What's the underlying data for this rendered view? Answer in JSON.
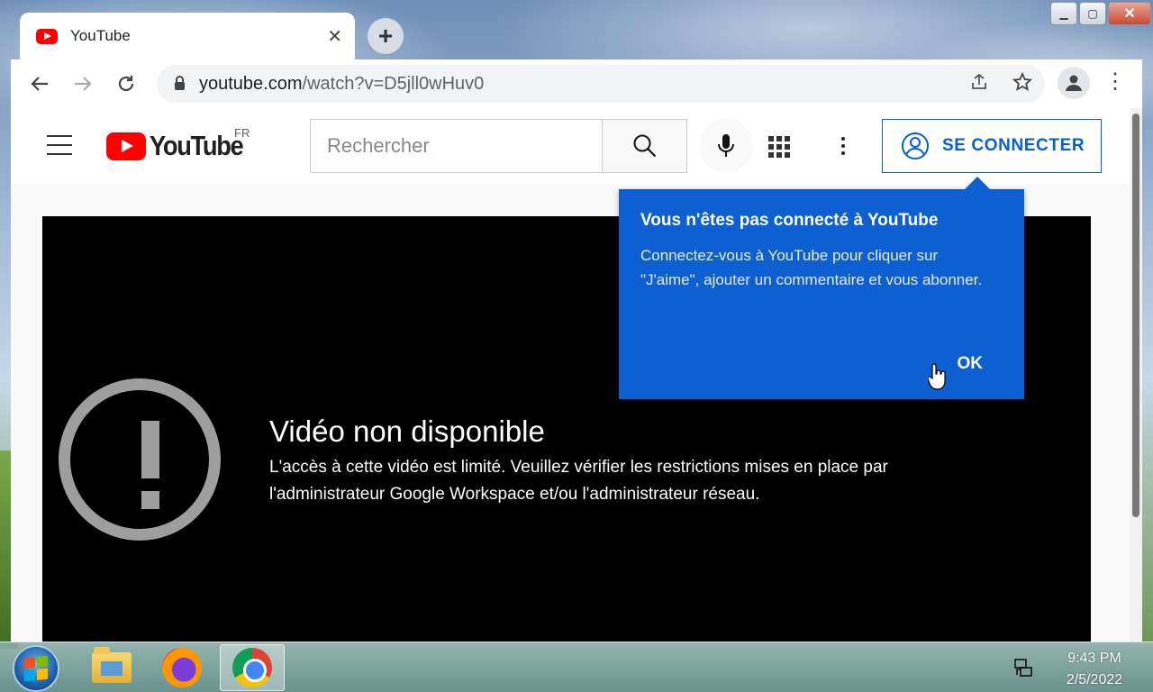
{
  "browser": {
    "tab_title": "YouTube",
    "url_host": "youtube.com",
    "url_path": "/watch?v=D5jll0wHuv0"
  },
  "youtube": {
    "logo_text": "YouTube",
    "region": "FR",
    "search_placeholder": "Rechercher",
    "signin_label": "SE CONNECTER"
  },
  "video": {
    "title": "Vidéo non disponible",
    "message": "L'accès à cette vidéo est limité. Veuillez vérifier les restrictions mises en place par l'administrateur Google Workspace et/ou l'administrateur réseau."
  },
  "tooltip": {
    "title": "Vous n'êtes pas connecté à YouTube",
    "body": "Connectez-vous à YouTube pour cliquer sur \"J'aime\", ajouter un commentaire et vous abonner.",
    "ok_label": "OK"
  },
  "taskbar": {
    "time": "9:43 PM",
    "date": "2/5/2022"
  },
  "colors": {
    "youtube_red": "#ff0000",
    "link_blue": "#065fd4",
    "tooltip_blue": "#0d5fd2"
  },
  "icons": [
    "back-icon",
    "forward-icon",
    "reload-icon",
    "lock-icon",
    "share-icon",
    "star-icon",
    "profile-icon",
    "menu-icon",
    "search-icon",
    "mic-icon",
    "apps-icon",
    "more-icon",
    "account-icon",
    "warning-icon",
    "start-icon",
    "folder-icon",
    "firefox-icon",
    "chrome-icon",
    "network-icon"
  ]
}
